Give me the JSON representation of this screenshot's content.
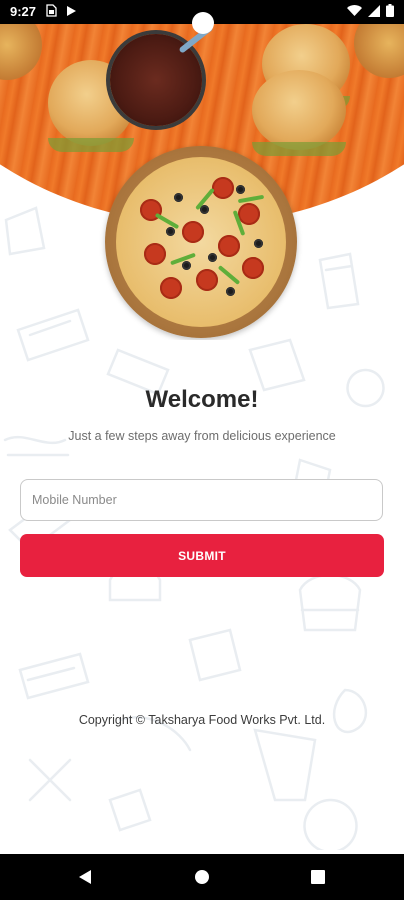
{
  "status_bar": {
    "time": "9:27",
    "sim_icon": "sim-card-icon",
    "play_icon": "play-store-icon",
    "wifi_icon": "wifi-icon",
    "signal_icon": "cell-signal-icon",
    "battery_icon": "battery-icon"
  },
  "main": {
    "title": "Welcome!",
    "subtitle": "Just a few steps away from delicious experience",
    "mobile_input": {
      "placeholder": "Mobile Number",
      "value": ""
    },
    "submit_label": "SUBMIT",
    "copyright": "Copyright ©  Taksharya Food Works Pvt. Ltd."
  },
  "nav_bar": {
    "back_icon": "back-triangle-icon",
    "home_icon": "home-circle-icon",
    "recents_icon": "recents-square-icon"
  },
  "colors": {
    "accent": "#e8213f",
    "table": "#e86a1f"
  }
}
